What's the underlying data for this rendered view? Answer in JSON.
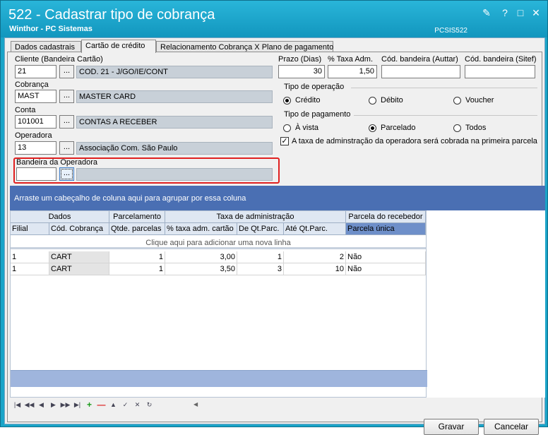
{
  "window": {
    "title": "522 - Cadastrar tipo de cobrança",
    "subtitle": "Winthor - PC Sistemas",
    "code": "PCSIS522"
  },
  "tabs": [
    {
      "label": "Dados cadastrais"
    },
    {
      "label": "Cartão de crédito"
    },
    {
      "label": "Relacionamento Cobrança X Plano de pagamento"
    }
  ],
  "form": {
    "cliente_label": "Cliente (Bandeira Cartão)",
    "cliente_code": "21",
    "cliente_desc": "COD. 21 - J/GO/IE/CONT",
    "cobranca_label": "Cobrança",
    "cobranca_code": "MAST",
    "cobranca_desc": "MASTER CARD",
    "conta_label": "Conta",
    "conta_code": "101001",
    "conta_desc": "CONTAS A RECEBER",
    "operadora_label": "Operadora",
    "operadora_code": "13",
    "operadora_desc": "Associação Com. São Paulo",
    "bandeira_label": "Bandeira da Operadora",
    "bandeira_code": "",
    "bandeira_desc": "",
    "dots_label": "...",
    "prazo_label": "Prazo (Dias)",
    "prazo_value": "30",
    "taxa_label": "% Taxa Adm.",
    "taxa_value": "1,50",
    "cod_auttar_label": "Cód. bandeira (Auttar)",
    "cod_auttar_value": "",
    "cod_sitef_label": "Cód. bandeira (Sitef)",
    "cod_sitef_value": "",
    "tipo_operacao_label": "Tipo de operação",
    "op_credito": "Crédito",
    "op_debito": "Débito",
    "op_voucher": "Voucher",
    "tipo_pagamento_label": "Tipo de pagamento",
    "pg_avista": "À vista",
    "pg_parcelado": "Parcelado",
    "pg_todos": "Todos",
    "checkbox_label": "A taxa de adminstração da operadora será cobrada na primeira parcela"
  },
  "grid": {
    "group_hint": "Arraste um cabeçalho de coluna aqui para agrupar por essa coluna",
    "bands": [
      "Dados",
      "Parcelamento",
      "Taxa de administração",
      "Parcela do recebedor"
    ],
    "columns": [
      "Filial",
      "Cód. Cobrança",
      "Qtde. parcelas",
      "% taxa adm. cartão",
      "De Qt.Parc.",
      "Até Qt.Parc.",
      "Parcela única"
    ],
    "new_row": "Clique aqui para adicionar uma nova linha",
    "rows": [
      [
        "1",
        "CART",
        "1",
        "3,00",
        "1",
        "2",
        "Não"
      ],
      [
        "1",
        "CART",
        "1",
        "3,50",
        "3",
        "10",
        "Não"
      ]
    ]
  },
  "buttons": {
    "gravar": "Gravar",
    "cancelar": "Cancelar"
  },
  "colors": {
    "titlebar": "#1aa4c8",
    "groupbar": "#4a6fb3",
    "highlight": "#e02020"
  }
}
